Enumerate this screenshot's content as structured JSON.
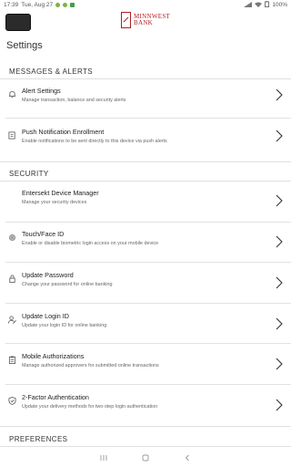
{
  "status": {
    "time": "17:39",
    "date": "Tue, Aug 27",
    "battery": "100%"
  },
  "brand": {
    "line1": "MINNWEST",
    "line2": "BANK"
  },
  "page": {
    "title": "Settings"
  },
  "sections": {
    "messages": "MESSAGES & ALERTS",
    "security": "SECURITY",
    "preferences": "PREFERENCES"
  },
  "items": [
    {
      "title": "Alert Settings",
      "desc": "Manage transaction, balance and security alerts",
      "icon": "bell-icon"
    },
    {
      "title": "Push Notification Enrollment",
      "desc": "Enable notifications to be sent directly to this device via push alerts",
      "icon": "push-notification-icon"
    },
    {
      "title": "Entersekt Device Manager",
      "desc": "Manage your security devices",
      "icon": ""
    },
    {
      "title": "Touch/Face ID",
      "desc": "Enable or disable biometric login access on your mobile device",
      "icon": "fingerprint-icon"
    },
    {
      "title": "Update Password",
      "desc": "Change your password for online banking",
      "icon": "lock-icon"
    },
    {
      "title": "Update Login ID",
      "desc": "Update your login ID for online banking",
      "icon": "user-edit-icon"
    },
    {
      "title": "Mobile Authorizations",
      "desc": "Manage authorized approvers for submitted online transactions",
      "icon": "clipboard-icon"
    },
    {
      "title": "2-Factor Authentication",
      "desc": "Update your delivery methods for two-step login authentication",
      "icon": "shield-icon"
    }
  ]
}
